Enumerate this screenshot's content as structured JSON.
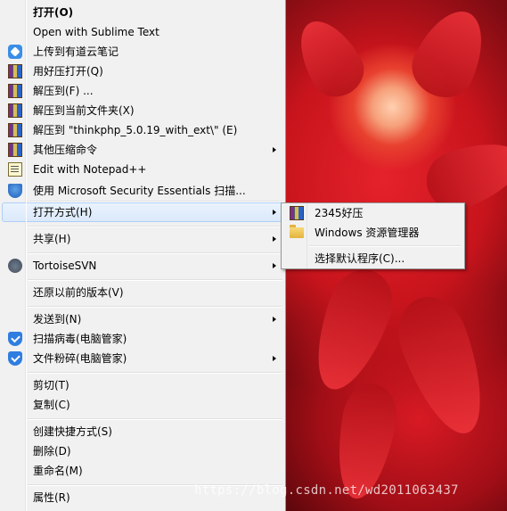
{
  "context_menu": {
    "items": [
      {
        "label": "打开(O)",
        "icon": "none",
        "bold": true
      },
      {
        "label": "Open with Sublime Text",
        "icon": "none"
      },
      {
        "label": "上传到有道云笔记",
        "icon": "youdao-note-icon"
      },
      {
        "label": "用好压打开(Q)",
        "icon": "haozip-icon"
      },
      {
        "label": "解压到(F) ...",
        "icon": "haozip-icon"
      },
      {
        "label": "解压到当前文件夹(X)",
        "icon": "haozip-icon"
      },
      {
        "label": "解压到 \"thinkphp_5.0.19_with_ext\\\" (E)",
        "icon": "haozip-icon"
      },
      {
        "label": "其他压缩命令",
        "icon": "haozip-icon",
        "submenu": true
      },
      {
        "label": "Edit with Notepad++",
        "icon": "notepad-plus-plus-icon"
      },
      {
        "label": "使用 Microsoft Security Essentials 扫描...",
        "icon": "security-essentials-icon"
      },
      {
        "label": "打开方式(H)",
        "icon": "none",
        "submenu": true,
        "highlighted": true
      },
      {
        "label": "共享(H)",
        "icon": "none",
        "submenu": true
      },
      {
        "label": "TortoiseSVN",
        "icon": "tortoisesvn-icon",
        "submenu": true
      },
      {
        "label": "还原以前的版本(V)",
        "icon": "none"
      },
      {
        "label": "发送到(N)",
        "icon": "none",
        "submenu": true
      },
      {
        "label": "扫描病毒(电脑管家)",
        "icon": "pc-manager-shield-icon"
      },
      {
        "label": "文件粉碎(电脑管家)",
        "icon": "pc-manager-shield-icon",
        "submenu": true
      },
      {
        "label": "剪切(T)",
        "icon": "none"
      },
      {
        "label": "复制(C)",
        "icon": "none"
      },
      {
        "label": "创建快捷方式(S)",
        "icon": "none"
      },
      {
        "label": "删除(D)",
        "icon": "none"
      },
      {
        "label": "重命名(M)",
        "icon": "none"
      },
      {
        "label": "属性(R)",
        "icon": "none"
      }
    ]
  },
  "open_with_submenu": {
    "items": [
      {
        "label": "2345好压",
        "icon": "haozip-icon"
      },
      {
        "label": "Windows 资源管理器",
        "icon": "folder-icon"
      },
      {
        "label": "选择默认程序(C)...",
        "icon": "none"
      }
    ]
  },
  "watermark": "https://blog.csdn.net/wd2011063437",
  "colors": {
    "menu_background": "#f1f1f1",
    "highlight_border": "#aecff7",
    "highlight_fill": "#dbe9fa",
    "wallpaper_red": "#d81a24"
  }
}
